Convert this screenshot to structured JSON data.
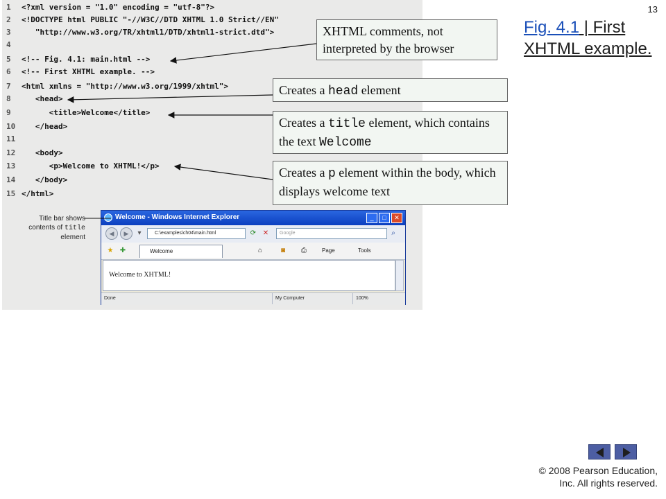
{
  "slide": {
    "number": "13",
    "title_link": "Fig. 4.1",
    "title_rest": " | First XHTML example.",
    "copyright_line1": "© 2008 Pearson Education,",
    "copyright_line2": "Inc.  All rights reserved."
  },
  "code_lines": [
    {
      "num": "1",
      "text": "<?xml version = \"1.0\" encoding = \"utf-8\"?>"
    },
    {
      "num": "2",
      "text": "<!DOCTYPE html PUBLIC \"-//W3C//DTD XHTML 1.0 Strict//EN\""
    },
    {
      "num": "3",
      "text": "   \"http://www.w3.org/TR/xhtml1/DTD/xhtml1-strict.dtd\">"
    },
    {
      "num": "4",
      "text": ""
    },
    {
      "num": "5",
      "text": "<!-- Fig. 4.1: main.html -->"
    },
    {
      "num": "6",
      "text": "<!-- First XHTML example. -->"
    },
    {
      "num": "7",
      "text": "<html xmlns = \"http://www.w3.org/1999/xhtml\">"
    },
    {
      "num": "8",
      "text": "   <head>"
    },
    {
      "num": "9",
      "text": "      <title>Welcome</title>"
    },
    {
      "num": "10",
      "text": "   </head>"
    },
    {
      "num": "11",
      "text": ""
    },
    {
      "num": "12",
      "text": "   <body>"
    },
    {
      "num": "13",
      "text": "      <p>Welcome to XHTML!</p>"
    },
    {
      "num": "14",
      "text": "   </body>"
    },
    {
      "num": "15",
      "text": "</html>"
    }
  ],
  "callouts": {
    "comments": "XHTML comments, not interpreted by the browser",
    "head_pre": "Creates a ",
    "head_code": "head",
    "head_post": " element",
    "title_pre": "Creates a ",
    "title_code": "title",
    "title_mid": " element, which contains the text ",
    "title_code2": "Welcome",
    "p_pre": "Creates a ",
    "p_code": "p",
    "p_post": " element within the body, which displays welcome text"
  },
  "titlebar_note": {
    "line1": "Title bar shows",
    "line2_pre": "contents of ",
    "line2_code": "title",
    "line3": "element"
  },
  "browser": {
    "window_title": "Welcome - Windows Internet Explorer",
    "address": "C:\\examples\\ch04\\main.html",
    "search_placeholder": "Google",
    "tab_label": "Welcome",
    "page_label": "Page",
    "tools_label": "Tools",
    "page_content": "Welcome to XHTML!",
    "status_done": "Done",
    "status_zone": "My Computer",
    "status_zoom": "100%"
  },
  "icons": {
    "back": "back-arrow-icon",
    "forward": "forward-arrow-icon",
    "refresh": "refresh-icon",
    "stop": "stop-icon",
    "search": "magnifier-icon",
    "favorites": "star-icon",
    "home": "home-icon",
    "print": "printer-icon",
    "prev_slide": "triangle-left-icon",
    "next_slide": "triangle-right-icon"
  },
  "colors": {
    "code_background": "#eaeae9",
    "callout_background": "#f2f6f2",
    "link": "#1a4fb8",
    "nav_button": "#4d5ea3",
    "xp_titlebar": "#0b3fbf"
  }
}
